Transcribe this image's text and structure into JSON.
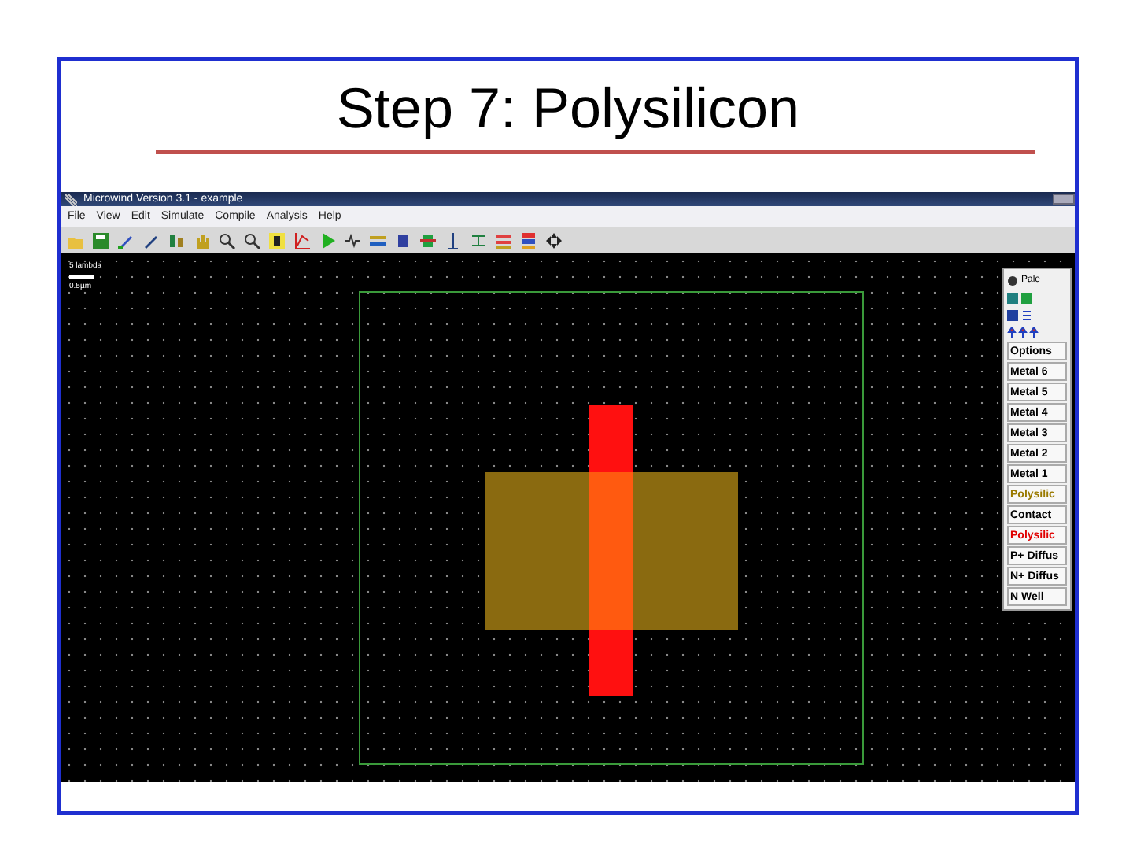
{
  "slide": {
    "title": "Step 7: Polysilicon"
  },
  "window": {
    "title": "Microwind Version 3.1 - example"
  },
  "menu": [
    "File",
    "View",
    "Edit",
    "Simulate",
    "Compile",
    "Analysis",
    "Help"
  ],
  "scale": {
    "label": "5 lambda",
    "size": "0.5µm"
  },
  "palette": {
    "title": "Pale",
    "items": [
      {
        "label": "Options",
        "color": "#000000"
      },
      {
        "label": "Metal 6",
        "color": "#000000"
      },
      {
        "label": "Metal 5",
        "color": "#000000"
      },
      {
        "label": "Metal 4",
        "color": "#000000"
      },
      {
        "label": "Metal 3",
        "color": "#000000"
      },
      {
        "label": "Metal 2",
        "color": "#000000"
      },
      {
        "label": "Metal 1",
        "color": "#000000"
      },
      {
        "label": "Polysilic",
        "color": "#9a7a00"
      },
      {
        "label": "Contact",
        "color": "#000000"
      },
      {
        "label": "Polysilic",
        "color": "#e00000"
      },
      {
        "label": "P+ Diffus",
        "color": "#000000"
      },
      {
        "label": "N+ Diffus",
        "color": "#000000"
      },
      {
        "label": "N Well",
        "color": "#000000"
      }
    ]
  }
}
